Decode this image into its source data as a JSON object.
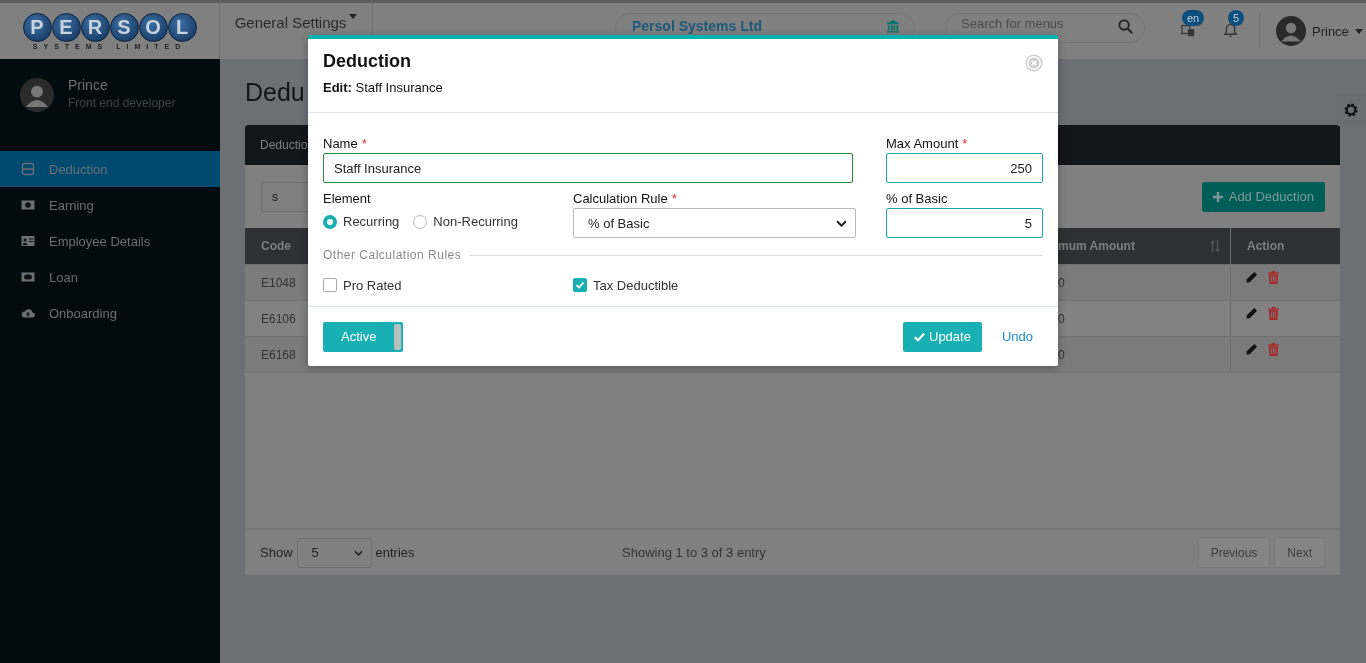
{
  "header": {
    "logo_letters": [
      "P",
      "E",
      "R",
      "S",
      "O",
      "L"
    ],
    "logo_subtitle": "SYSTEMS LIMITED",
    "menu": "General Settings",
    "company": "Persol Systems Ltd",
    "search": {
      "placeholder": "Search for menus"
    },
    "language_badge": "en",
    "notification_count": "5",
    "user": "Prince"
  },
  "sidebar": {
    "profile": {
      "name": "Prince",
      "role": "Front end developer"
    },
    "items": [
      {
        "label": "Deduction",
        "selected": true
      },
      {
        "label": "Earning",
        "selected": false
      },
      {
        "label": "Employee Details",
        "selected": false
      },
      {
        "label": "Loan",
        "selected": false
      },
      {
        "label": "Onboarding",
        "selected": false
      }
    ]
  },
  "page": {
    "heading": "Dedu",
    "card_title": "Deductio",
    "filter": {
      "value": "s"
    },
    "add_button": "Add Deduction",
    "table": {
      "columns": [
        {
          "label": "Code",
          "sortable": false
        },
        {
          "label": "mum Amount",
          "sortable": true
        },
        {
          "label": "Action",
          "sortable": false
        }
      ],
      "rows": [
        {
          "code": "E1048",
          "amount": "0"
        },
        {
          "code": "E6106",
          "amount": "0"
        },
        {
          "code": "E6168",
          "amount": "0"
        }
      ]
    },
    "footer": {
      "show_label": "Show",
      "page_size": "5",
      "entries_label": "entries",
      "summary": "Showing 1 to 3 of 3 entry",
      "previous": {
        "label": "Previous",
        "disabled": true
      },
      "next": {
        "label": "Next",
        "disabled": true
      }
    }
  },
  "modal": {
    "title": "Deduction",
    "subtitle": "**Edit:** Staff Insurance",
    "name": {
      "label": "Name",
      "required_mark": "*",
      "value": "Staff Insurance"
    },
    "max_amount": {
      "label": "Max Amount",
      "required_mark": "*",
      "value": "250"
    },
    "element": {
      "label": "Element",
      "options": [
        {
          "label": "Recurring",
          "selected": true
        },
        {
          "label": "Non-Recurring",
          "selected": false
        }
      ]
    },
    "calculation_rule": {
      "label": "Calculation Rule",
      "required_mark": "*",
      "value": "% of Basic"
    },
    "percent_of_basic": {
      "label": "% of Basic",
      "value": "5"
    },
    "other_rules": {
      "label": "Other Calculation Rules",
      "options": [
        {
          "label": "Pro Rated",
          "checked": false
        },
        {
          "label": "Tax Deductible",
          "checked": true
        }
      ]
    },
    "status_toggle": {
      "label": "Active",
      "on": true
    },
    "update_button": "Update",
    "undo_link": "Undo"
  }
}
